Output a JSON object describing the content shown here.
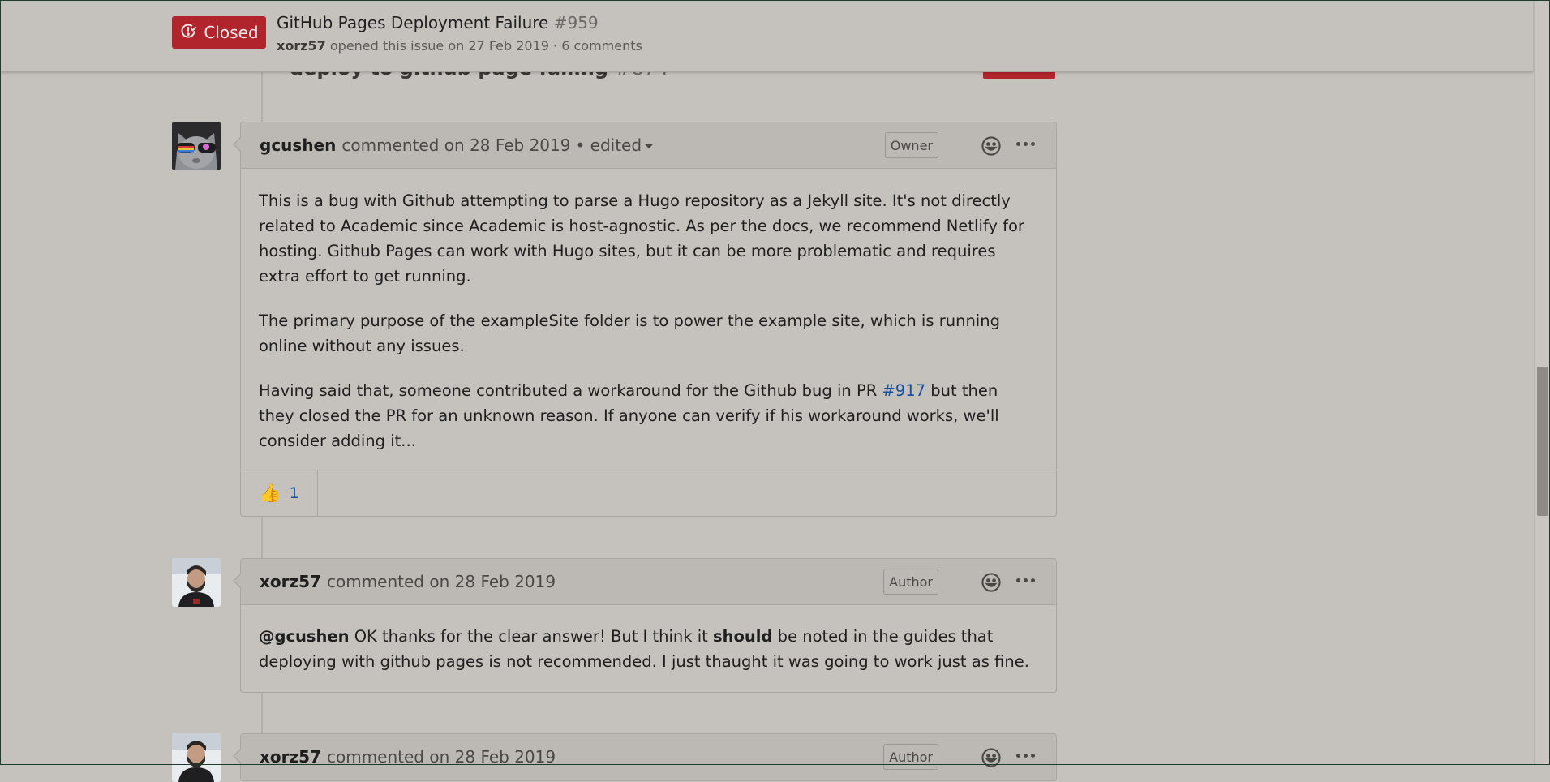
{
  "header": {
    "state_label": "Closed",
    "title": "GitHub Pages Deployment Failure",
    "number": "#959",
    "author": "xorz57",
    "meta_rest": "opened this issue on 27 Feb 2019 · 6 comments"
  },
  "referenced_item": {
    "title": "deploy to github page failing",
    "number": "#874"
  },
  "comments": [
    {
      "author": "gcushen",
      "action": "commented on 28 Feb 2019",
      "edited_label": "• edited",
      "role": "Owner",
      "paragraphs": [
        "This is a bug with Github attempting to parse a Hugo repository as a Jekyll site. It's not directly related to Academic since Academic is host-agnostic. As per the docs, we recommend Netlify for hosting. Github Pages can work with Hugo sites, but it can be more problematic and requires extra effort to get running.",
        "The primary purpose of the exampleSite folder is to power the example site, which is running online without any issues."
      ],
      "p3_before": "Having said that, someone contributed a workaround for the Github bug in PR",
      "p3_link": "#917",
      "p3_after": "but then they closed the PR for an unknown reason. If anyone can verify if his workaround works, we'll consider adding it...",
      "reaction_emoji": "👍",
      "reaction_count": "1"
    },
    {
      "author": "xorz57",
      "action": "commented on 28 Feb 2019",
      "role": "Author",
      "mention": "@gcushen",
      "text_before_bold": "OK thanks for the clear answer! But I think it",
      "bold": "should",
      "text_after_bold": "be noted in the guides that deploying with github pages is not recommended. I just thaught it was going to work just as fine."
    },
    {
      "author": "xorz57",
      "action": "commented on 28 Feb 2019",
      "role": "Author"
    }
  ],
  "icons": {
    "state": "issue-closed-icon",
    "reaction": "smiley-icon",
    "more": "kebab-horizontal-icon",
    "thumbs_up": "thumbs-up-icon"
  },
  "colors": {
    "background": "#c5c2bd",
    "closed_badge": "#b1242b",
    "link": "#1a4f9c"
  }
}
